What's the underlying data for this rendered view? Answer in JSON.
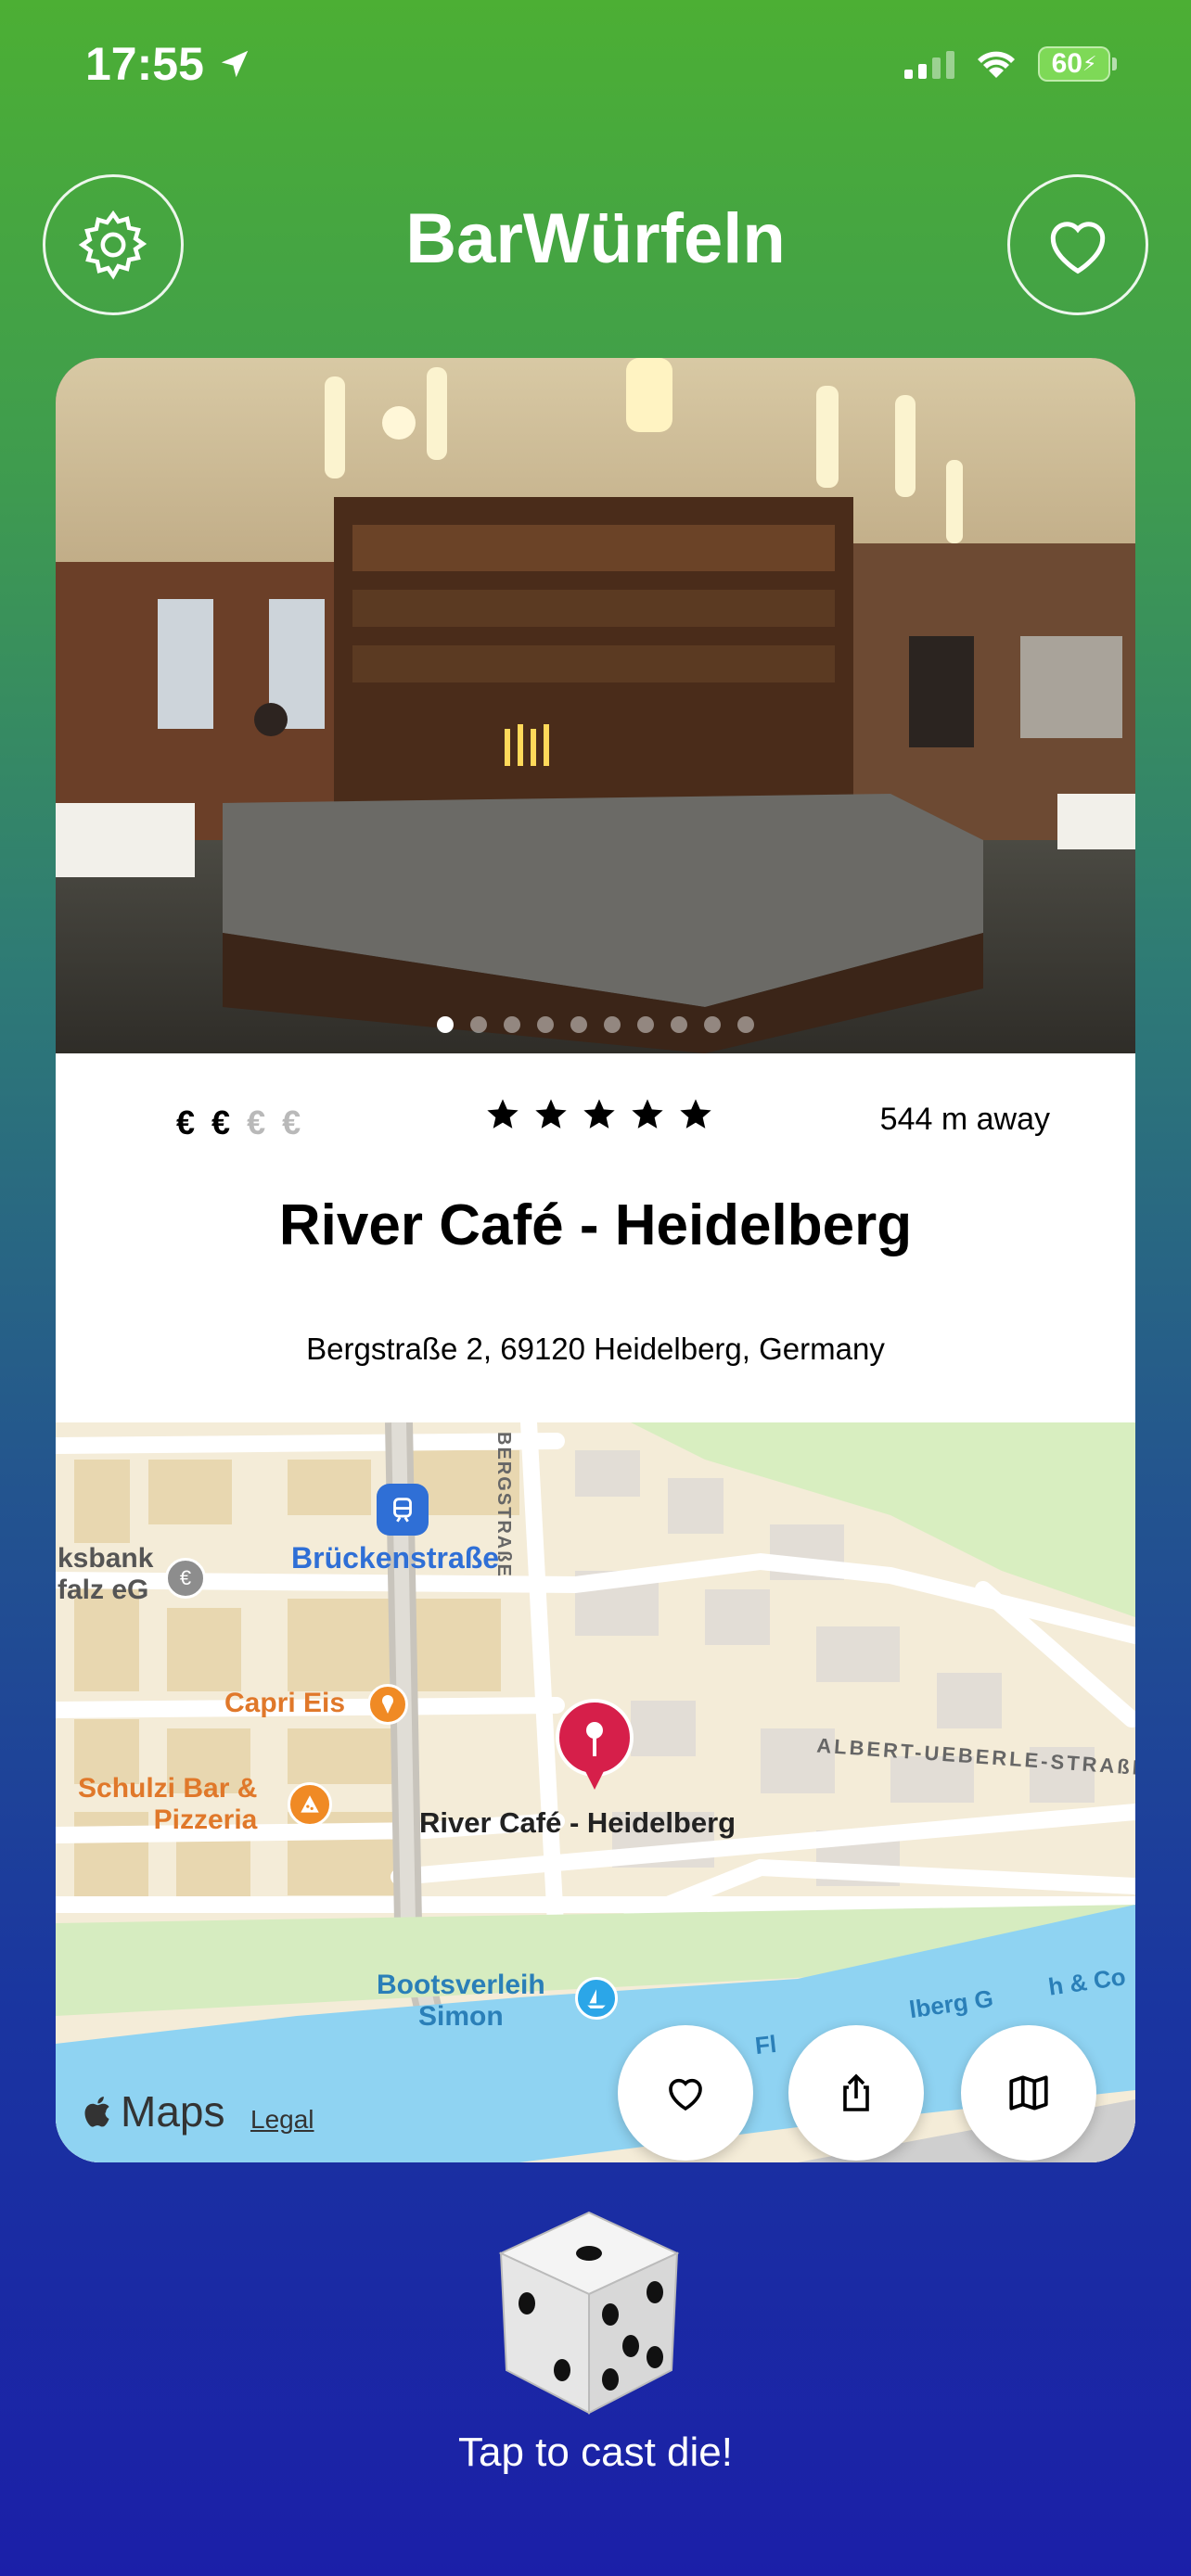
{
  "status_bar": {
    "time": "17:55",
    "battery": "60"
  },
  "header": {
    "title": "BarWürfeln",
    "settings_icon": "gear-icon",
    "favorites_icon": "heart-icon"
  },
  "venue": {
    "price_level": 2,
    "price_symbols_active": "€ €",
    "price_symbols_inactive": "€ €",
    "rating_stars": 5,
    "distance": "544 m away",
    "name": "River Café - Heidelberg",
    "address": "Bergstraße 2, 69120 Heidelberg, Germany",
    "photo_count": 10,
    "photo_index": 1
  },
  "map": {
    "labels": {
      "street_bergstrasse": "BERGSTRAßE",
      "transit": "Brückenstraße",
      "bank_line1": "ksbank",
      "bank_line2": "falz eG",
      "capri": "Capri Eis",
      "schulzi_line1": "Schulzi Bar &",
      "schulzi_line2": "Pizzeria",
      "pin_label": "River Café - Heidelberg",
      "albert": "ALBERT-UEBERLE-STRAßE",
      "boots_line1": "Bootsverleih",
      "boots_line2": "Simon",
      "river_fragment1": "Fl",
      "river_fragment2": "lberg G",
      "river_fragment3": "h & Co",
      "maps_brand": "Maps",
      "legal": "Legal"
    },
    "actions": {
      "favorite_icon": "heart-icon",
      "share_icon": "share-icon",
      "map_icon": "map-icon"
    }
  },
  "dice": {
    "caption": "Tap to cast die!"
  },
  "colors": {
    "gradient_top": "#4caf34",
    "gradient_bottom": "#1b1fa8",
    "pin": "#d61f4a",
    "transit": "#2f6fd6",
    "poi_orange": "#f08a24",
    "water": "#8fd3f2"
  }
}
